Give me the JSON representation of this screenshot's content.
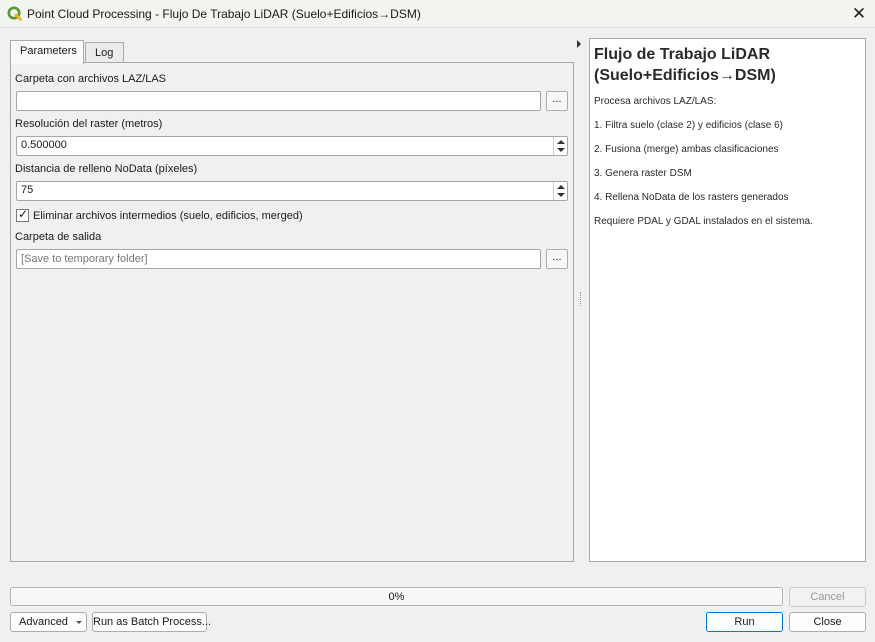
{
  "window": {
    "title": "Point Cloud Processing - Flujo De Trabajo LiDAR (Suelo+Edificios→DSM)",
    "close_glyph": "✕"
  },
  "tabs": [
    {
      "label": "Parameters",
      "active": true
    },
    {
      "label": "Log",
      "active": false
    }
  ],
  "params": {
    "input_folder": {
      "label": "Carpeta con archivos LAZ/LAS",
      "value": "",
      "browse_label": "..."
    },
    "resolution": {
      "label": "Resolución del raster (metros)",
      "value": "0.500000"
    },
    "nodata_fill": {
      "label": "Distancia de relleno NoData (píxeles)",
      "value": "75"
    },
    "delete_intermediate": {
      "label": "Eliminar archivos intermedios (suelo, edificios, merged)",
      "checked": true,
      "check_glyph": "✓"
    },
    "output_folder": {
      "label": "Carpeta de salida",
      "placeholder": "[Save to temporary folder]",
      "browse_label": "..."
    }
  },
  "help": {
    "title": "Flujo de Trabajo LiDAR (Suelo+Edificios→DSM)",
    "lines": [
      "Procesa archivos LAZ/LAS:",
      "1. Filtra suelo (clase 2) y edificios (clase 6)",
      "2. Fusiona (merge) ambas clasificaciones",
      "3. Genera raster DSM",
      "4. Rellena NoData de los rasters generados",
      "Requiere PDAL y GDAL instalados en el sistema."
    ]
  },
  "progress": {
    "value": 0,
    "text": "0%"
  },
  "buttons": {
    "cancel": "Cancel",
    "advanced": "Advanced",
    "batch": "Run as Batch Process...",
    "run": "Run",
    "close": "Close"
  },
  "colors": {
    "app_icon": "#589632",
    "primary_border": "#0078d4"
  },
  "icons": {
    "app": "qgis-icon",
    "close": "close-icon",
    "check": "check-icon",
    "caret": "chevron-down-icon"
  }
}
